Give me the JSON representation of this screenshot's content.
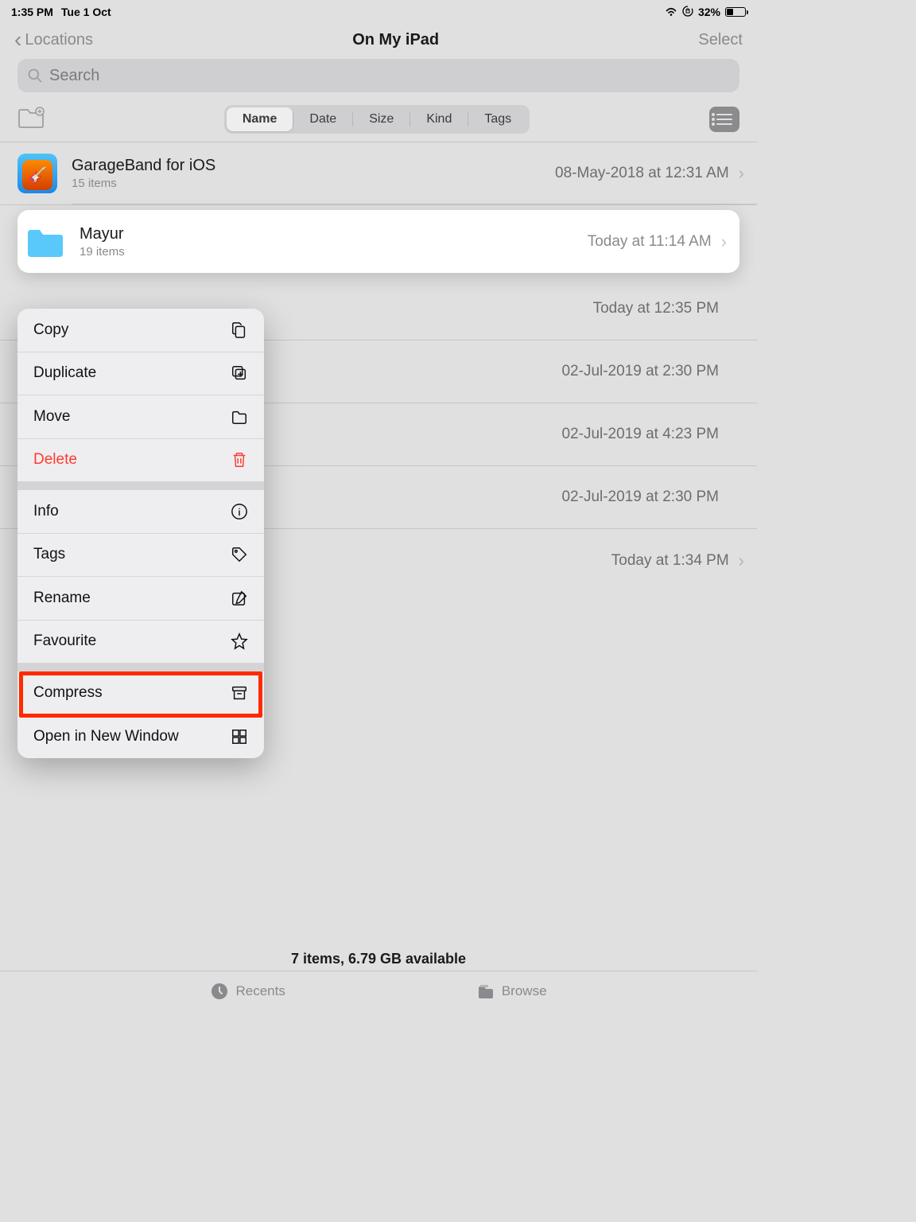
{
  "status": {
    "time": "1:35 PM",
    "date": "Tue 1 Oct",
    "battery_pct": "32%"
  },
  "nav": {
    "back": "Locations",
    "title": "On My iPad",
    "action": "Select"
  },
  "search": {
    "placeholder": "Search"
  },
  "sort": {
    "options": [
      "Name",
      "Date",
      "Size",
      "Kind",
      "Tags"
    ],
    "active": 0
  },
  "files": [
    {
      "name": "GarageBand for iOS",
      "sub": "15 items",
      "date": "08-May-2018 at 12:31 AM",
      "type": "app"
    },
    {
      "name": "Mayur",
      "sub": "19 items",
      "date": "Today at 11:14 AM",
      "type": "folder",
      "selected": true
    },
    {
      "name": "",
      "sub": "",
      "date": "Today at 12:35 PM",
      "type": "hidden"
    },
    {
      "name": "",
      "sub": "",
      "date": "02-Jul-2019 at 2:30 PM",
      "type": "hidden"
    },
    {
      "name": "",
      "sub": "",
      "date": "02-Jul-2019 at 4:23 PM",
      "type": "hidden"
    },
    {
      "name": "",
      "sub": "",
      "date": "02-Jul-2019 at 2:30 PM",
      "type": "hidden"
    },
    {
      "name": "",
      "sub": "",
      "date": "Today at 1:34 PM",
      "type": "hidden",
      "chevron": true
    }
  ],
  "context_menu": {
    "groups": [
      [
        {
          "label": "Copy",
          "icon": "copy"
        },
        {
          "label": "Duplicate",
          "icon": "duplicate"
        },
        {
          "label": "Move",
          "icon": "folder"
        },
        {
          "label": "Delete",
          "icon": "trash",
          "destructive": true
        }
      ],
      [
        {
          "label": "Info",
          "icon": "info"
        },
        {
          "label": "Tags",
          "icon": "tag"
        },
        {
          "label": "Rename",
          "icon": "rename"
        },
        {
          "label": "Favourite",
          "icon": "star"
        }
      ],
      [
        {
          "label": "Compress",
          "icon": "archive",
          "highlighted": true
        },
        {
          "label": "Open in New Window",
          "icon": "grid"
        }
      ]
    ]
  },
  "footer": {
    "status": "7 items, 6.79 GB available",
    "tabs": [
      "Recents",
      "Browse"
    ]
  }
}
